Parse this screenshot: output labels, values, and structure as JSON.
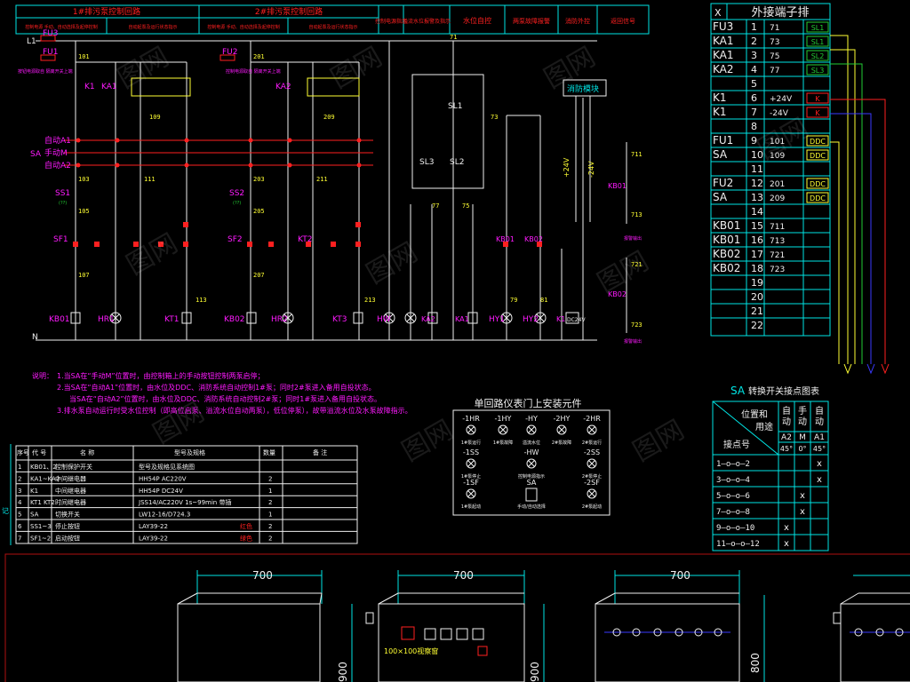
{
  "app": {
    "background": "#000000",
    "colors": {
      "cyan": "#00e5e5",
      "white": "#f0f0f0",
      "red": "#ff2020",
      "magenta": "#ff1aff",
      "yellow": "#ffff33",
      "green": "#22cc33",
      "blue": "#3a3aff",
      "dim_red": "#b01010",
      "gray": "#8a8a8a"
    }
  },
  "header": {
    "cells": [
      "1#排污泵控制回路",
      "2#排污泵控制回路",
      "控制电源指示",
      "溢流水位报警及指示",
      "水位自控",
      "两泵故障报警",
      "消防外控",
      "返回信号"
    ],
    "sub_cells": [
      "控制电源 手动、自动选择及起停控制",
      "自动起泵及运行状态指示",
      "控制电源 手动、自动选择及起停控制",
      "自动起泵及运行状态指示"
    ]
  },
  "circuit": {
    "bus_labels": [
      "L1",
      "N",
      "SA",
      "自动A1",
      "手动M",
      "自动A2"
    ],
    "device_labels": [
      "FU3",
      "FU1",
      "FU2",
      "KA1",
      "KA2",
      "K1",
      "SS1",
      "SS2",
      "SF1",
      "SF2",
      "KB01",
      "KB02",
      "KT1",
      "KT2",
      "KT3",
      "HR1",
      "HR2",
      "HW",
      "HY1",
      "HY2",
      "SL1",
      "SL2",
      "SL3",
      "消防模块",
      "+24V",
      "-24V",
      "DC24V"
    ],
    "wire_numbers": [
      "101",
      "103",
      "105",
      "107",
      "109",
      "111",
      "113",
      "201",
      "203",
      "205",
      "207",
      "209",
      "211",
      "213",
      "71",
      "73",
      "75",
      "77",
      "79",
      "81",
      "711",
      "713",
      "721",
      "723"
    ],
    "small_notes": [
      "按钮电源取自 隔离开关上端",
      "控制电源取自 隔离开关上端",
      "(??)",
      "报警输出"
    ]
  },
  "notes": {
    "title": "说明：",
    "lines": [
      "1.当SA在“手动M”位置时，由控制箱上的手动按钮控制两泵启停；",
      "2.当SA在“自动A1”位置时，由水位及DDC、消防系统自动控制1#泵；同时2#泵进入备用自投状态。",
      "当SA在“自动A2”位置时，由水位及DDC、消防系统自动控制2#泵；同时1#泵进入备用自投状态。",
      "3.排水泵自动运行时受水位控制（即高位启泵、溢流水位自动两泵），低位停泵），故带溢流水位及水泵故障指示。"
    ]
  },
  "terminal": {
    "x_label": "X",
    "title": "外接端子排",
    "rows": [
      {
        "dev": "FU3",
        "no": "1",
        "wire": "71",
        "tag": "SL1"
      },
      {
        "dev": "KA1",
        "no": "2",
        "wire": "73",
        "tag": "SL1"
      },
      {
        "dev": "KA1",
        "no": "3",
        "wire": "75",
        "tag": "SL2"
      },
      {
        "dev": "KA2",
        "no": "4",
        "wire": "77",
        "tag": "SL3"
      },
      {
        "dev": "",
        "no": "5",
        "wire": "",
        "tag": ""
      },
      {
        "dev": "K1",
        "no": "6",
        "wire": "+24V",
        "tag": "K"
      },
      {
        "dev": "K1",
        "no": "7",
        "wire": "-24V",
        "tag": "K"
      },
      {
        "dev": "",
        "no": "8",
        "wire": "",
        "tag": ""
      },
      {
        "dev": "FU1",
        "no": "9",
        "wire": "101",
        "tag": "DDC"
      },
      {
        "dev": "SA",
        "no": "10",
        "wire": "109",
        "tag": "DDC"
      },
      {
        "dev": "",
        "no": "11",
        "wire": "",
        "tag": ""
      },
      {
        "dev": "FU2",
        "no": "12",
        "wire": "201",
        "tag": "DDC"
      },
      {
        "dev": "SA",
        "no": "13",
        "wire": "209",
        "tag": "DDC"
      },
      {
        "dev": "",
        "no": "14",
        "wire": "",
        "tag": ""
      },
      {
        "dev": "KB01",
        "no": "15",
        "wire": "711",
        "tag": ""
      },
      {
        "dev": "KB01",
        "no": "16",
        "wire": "713",
        "tag": ""
      },
      {
        "dev": "KB02",
        "no": "17",
        "wire": "721",
        "tag": ""
      },
      {
        "dev": "KB02",
        "no": "18",
        "wire": "723",
        "tag": ""
      },
      {
        "dev": "",
        "no": "19",
        "wire": "",
        "tag": ""
      },
      {
        "dev": "",
        "no": "20",
        "wire": "",
        "tag": ""
      },
      {
        "dev": "",
        "no": "21",
        "wire": "",
        "tag": ""
      },
      {
        "dev": "",
        "no": "22",
        "wire": "",
        "tag": ""
      }
    ]
  },
  "switch_table": {
    "title_sa": "SA",
    "title": "转换开关接点图表",
    "header_pos": "位置和",
    "header_use": "用途",
    "header_contact": "接点号",
    "modes": [
      {
        "name": "自动",
        "code": "A2",
        "angle": "45°"
      },
      {
        "name": "手动",
        "code": "M",
        "angle": "0°"
      },
      {
        "name": "自动",
        "code": "A1",
        "angle": "45°"
      }
    ],
    "rows": [
      {
        "contact": "1—o—o—2",
        "marks": [
          "",
          "",
          "x"
        ]
      },
      {
        "contact": "3—o—o—4",
        "marks": [
          "",
          "",
          "x"
        ]
      },
      {
        "contact": "5—o—o—6",
        "marks": [
          "",
          "x",
          ""
        ]
      },
      {
        "contact": "7—o—o—8",
        "marks": [
          "",
          "x",
          ""
        ]
      },
      {
        "contact": "9—o—o—10",
        "marks": [
          "x",
          "",
          ""
        ]
      },
      {
        "contact": "11—o—o—12",
        "marks": [
          "x",
          "",
          ""
        ]
      }
    ]
  },
  "door_panel": {
    "title": "单回路仪表门上安装元件",
    "items": [
      {
        "code": "-1HR",
        "desc": "1#泵运行"
      },
      {
        "code": "-1HY",
        "desc": "1#泵故障"
      },
      {
        "code": "-HY",
        "desc": "溢流水位"
      },
      {
        "code": "-2HY",
        "desc": "2#泵故障"
      },
      {
        "code": "-2HR",
        "desc": "2#泵运行"
      },
      {
        "code": "-1SS",
        "desc": "1#泵停止"
      },
      {
        "code": "-HW",
        "desc": "控制电源指示"
      },
      {
        "code": "-2SS",
        "desc": "2#泵停止"
      },
      {
        "code": "-1SF",
        "desc": "1#泵起动"
      },
      {
        "code": "SA",
        "desc": "手动/自动选择"
      },
      {
        "code": "-2SF",
        "desc": "2#泵起动"
      }
    ]
  },
  "bom": {
    "headers": [
      "序号",
      "代 号",
      "名 称",
      "型号及规格",
      "数量",
      "备 注"
    ],
    "rows": [
      {
        "no": "1",
        "code": "KB01、2",
        "name": "控制保护开关",
        "spec": "型号及规格见系统图",
        "qty": "",
        "note": ""
      },
      {
        "no": "2",
        "code": "KA1~KA2",
        "name": "中间继电器",
        "spec": "HH54P  AC220V",
        "qty": "2",
        "note": ""
      },
      {
        "no": "3",
        "code": "K1",
        "name": "中间继电器",
        "spec": "HH54P  DC24V",
        "qty": "1",
        "note": ""
      },
      {
        "no": "4",
        "code": "KT1 KT2",
        "name": "时间继电器",
        "spec": "JSS14/AC220V  1s~99min 带插",
        "qty": "2",
        "note": ""
      },
      {
        "no": "5",
        "code": "SA",
        "name": "切换开关",
        "spec": "LW12-16/D724.3",
        "qty": "1",
        "note": ""
      },
      {
        "no": "6",
        "code": "SS1~3",
        "name": "停止按钮",
        "spec": "LAY39-22",
        "qty": "2",
        "note": "红色"
      },
      {
        "no": "7",
        "code": "SF1~2",
        "name": "启动按钮",
        "spec": "LAY39-22",
        "qty": "2",
        "note": "绿色"
      }
    ],
    "side_label": "记"
  },
  "cabinets": {
    "dims": [
      "700",
      "700",
      "700"
    ],
    "heights": [
      "900",
      "800"
    ],
    "left_display": "100×100视察窗"
  },
  "watermarks": [
    "图网",
    "图网",
    "图网",
    "图网",
    "图网",
    "图网",
    "图网",
    "图网",
    "图网",
    "图网"
  ]
}
